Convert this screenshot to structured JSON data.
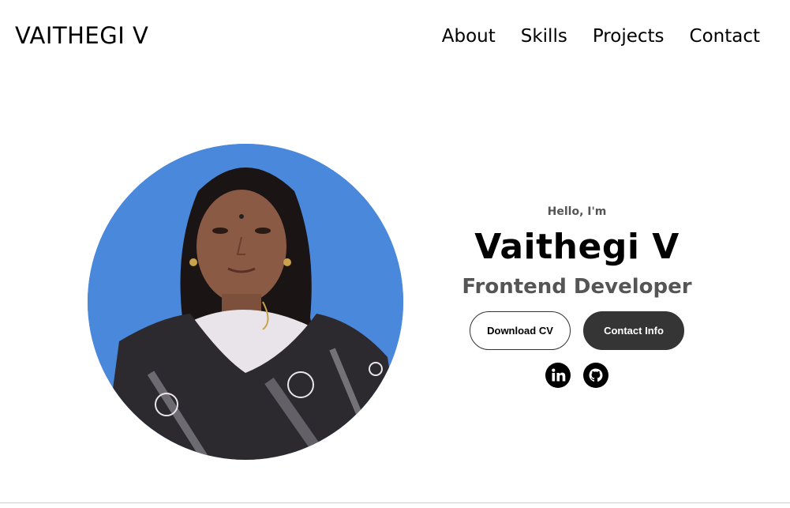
{
  "nav": {
    "logo": "VAITHEGI V",
    "links": [
      {
        "label": "About"
      },
      {
        "label": "Skills"
      },
      {
        "label": "Projects"
      },
      {
        "label": "Contact"
      }
    ]
  },
  "profile": {
    "background_color": "#4a88db"
  },
  "intro": {
    "greeting": "Hello, I'm",
    "name": "Vaithegi V",
    "role": "Frontend Developer"
  },
  "buttons": {
    "download_cv": "Download CV",
    "contact_info": "Contact Info"
  },
  "socials": [
    {
      "icon": "linkedin-icon"
    },
    {
      "icon": "github-icon"
    }
  ],
  "colors": {
    "text": "#000000",
    "muted": "#555555",
    "button_dark": "#353535"
  }
}
